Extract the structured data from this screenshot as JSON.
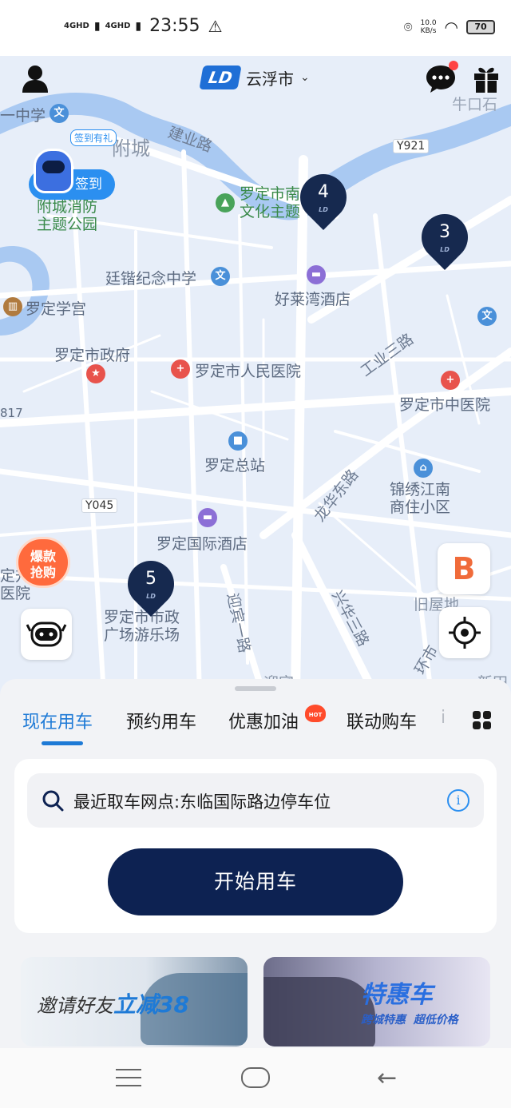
{
  "status_bar": {
    "net1": "4GHD",
    "net2": "4GHD",
    "time": "23:55",
    "speed_value": "10.0",
    "speed_unit": "KB/s",
    "battery": "70"
  },
  "header": {
    "brand_logo": "LD",
    "city": "云浮市"
  },
  "checkin": {
    "tag": "签到有礼",
    "label": "签到"
  },
  "map": {
    "labels": {
      "school1": "一中学",
      "town": "附城",
      "road_jianye": "建业路",
      "park": "附城消防\n主题公园",
      "culture_park": "罗定市南\n文化主题",
      "niukou": "牛口石",
      "y921": "Y921",
      "school2": "廷锴纪念中学",
      "hotel1": "好莱湾酒店",
      "school3": "罗定学宫",
      "gov": "罗定市政府",
      "hospital1": "罗定市人民医院",
      "road_gongye": "工业三路",
      "hospital2": "罗定市中医院",
      "r817": "817",
      "station": "罗定总站",
      "y045": "Y045",
      "road_longhua": "龙华东路",
      "residence": "锦绣江南\n商住小区",
      "hotel2": "罗定国际酒店",
      "road_yingbin": "迎宾一路",
      "road_xinghua": "兴华三路",
      "old_house": "旧屋地",
      "plaza": "罗定市市政\n广场游乐场",
      "edge1": "定升\n医院",
      "road_huanshi": "环市",
      "xintian": "新田",
      "yingbin2": "迎宾"
    },
    "clusters": [
      "4",
      "3",
      "5"
    ]
  },
  "promo_badge": "爆款\n抢购",
  "tabs": {
    "items": [
      "现在用车",
      "预约用车",
      "优惠加油",
      "联动购车"
    ],
    "hot_badge": "HOT",
    "overflow": "i"
  },
  "search": {
    "text": "最近取车网点:东临国际路边停车位"
  },
  "start_button": "开始用车",
  "banners": {
    "invite_prefix": "邀请好友",
    "invite_highlight": "立减38",
    "deal_title": "特惠车",
    "deal_sub": "跨城特惠  超低价格"
  },
  "colors": {
    "accent": "#1e7ad6",
    "primary_button": "#0d2252",
    "cluster_pin": "#16294f"
  },
  "icons": [
    "user-icon",
    "chevron-down-icon",
    "message-icon",
    "gift-icon",
    "search-icon",
    "info-icon",
    "locate-icon",
    "grid-icon",
    "customer-service-icon"
  ]
}
